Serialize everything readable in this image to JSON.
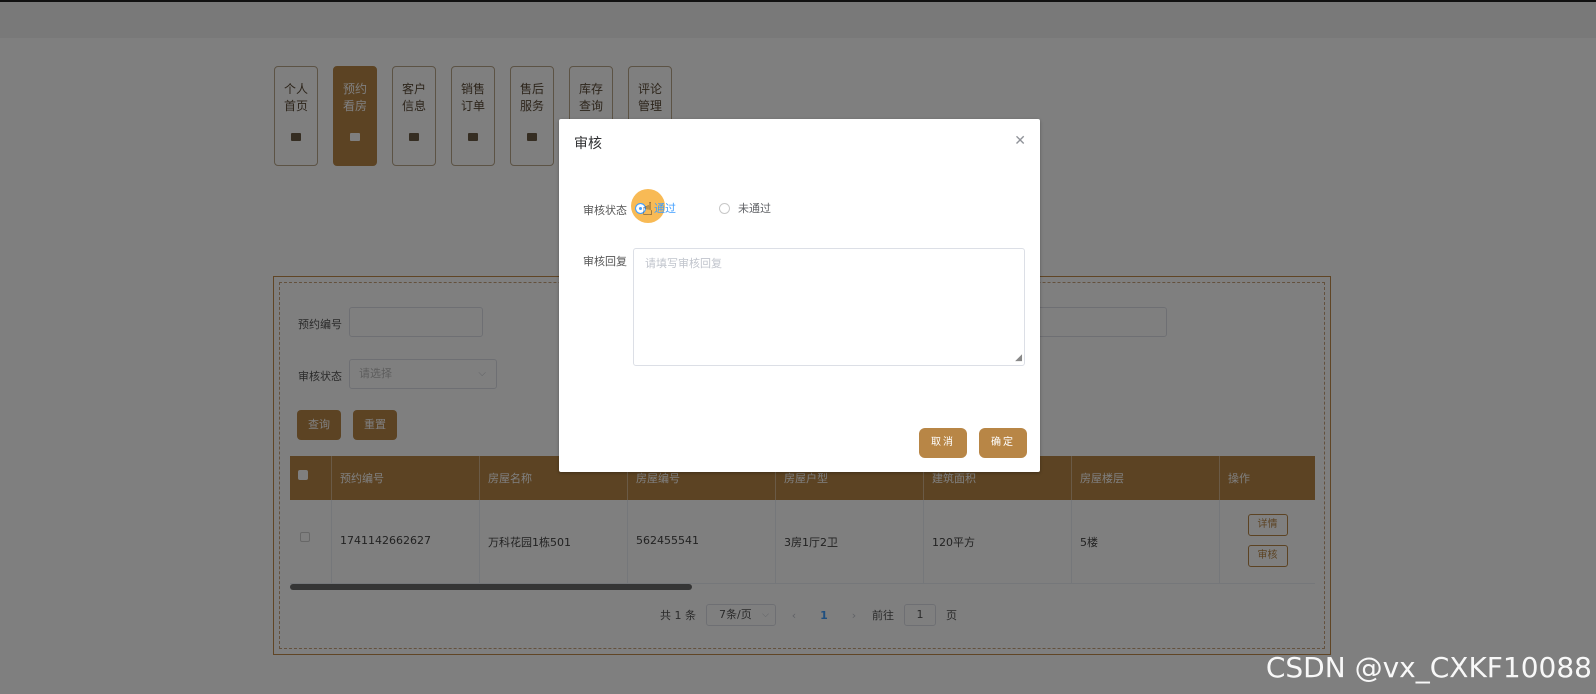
{
  "nav": {
    "items": [
      {
        "label": "个人首页"
      },
      {
        "label": "预约看房"
      },
      {
        "label": "客户信息"
      },
      {
        "label": "销售订单"
      },
      {
        "label": "售后服务"
      },
      {
        "label": "库存查询"
      },
      {
        "label": "评论管理"
      }
    ],
    "active_index": 1
  },
  "search": {
    "id_label": "预约编号",
    "status_label": "审核状态",
    "status_placeholder": "请选择",
    "query_button": "查询",
    "reset_button": "重置"
  },
  "table": {
    "headers": [
      "预约编号",
      "房屋名称",
      "房屋编号",
      "房屋户型",
      "建筑面积",
      "房屋楼层",
      "操作"
    ],
    "rows": [
      {
        "id": "1741142662627",
        "name": "万科花园1栋501",
        "code": "562455541",
        "layout": "3房1厅2卫",
        "area": "120平方",
        "floor": "5楼"
      }
    ],
    "detail_button": "详情",
    "review_button": "审核"
  },
  "pagination": {
    "total": "共 1 条",
    "page_size": "7条/页",
    "current": "1",
    "goto_label": "前往",
    "goto_value": "1",
    "page_suffix": "页"
  },
  "dialog": {
    "title": "审核",
    "status_label": "审核状态",
    "pass_option": "通过",
    "fail_option": "未通过",
    "reply_label": "审核回复",
    "reply_placeholder": "请填写审核回复",
    "cancel_button": "取消",
    "confirm_button": "确定"
  },
  "watermark": "CSDN @vx_CXKF10088",
  "colors": {
    "accent": "#b88646",
    "link": "#409eff"
  }
}
